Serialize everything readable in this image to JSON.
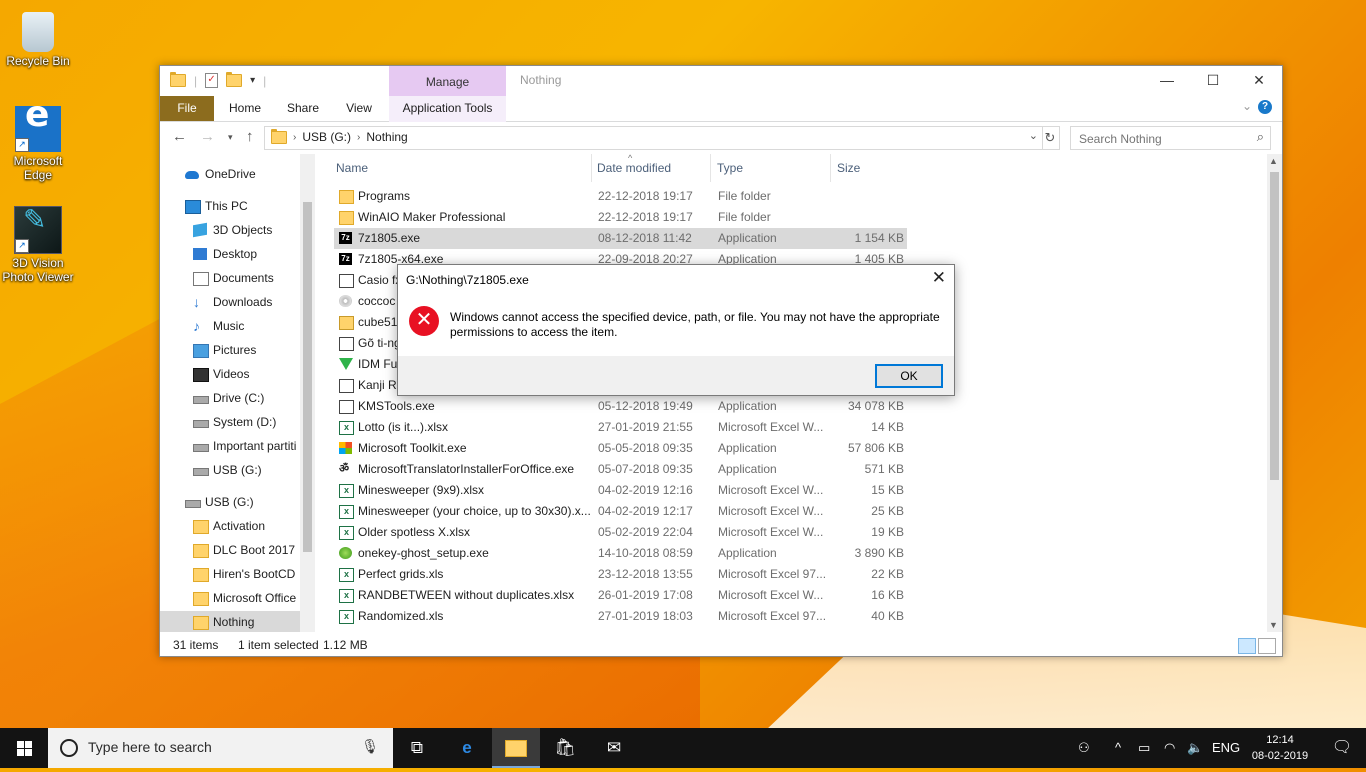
{
  "desktop": {
    "icons": [
      {
        "label": "Recycle Bin",
        "icon": "recycle-bin-icon"
      },
      {
        "label": "Microsoft Edge",
        "icon": "edge-icon"
      },
      {
        "label": "3D Vision Photo Viewer",
        "icon": "3d-vision-icon"
      }
    ]
  },
  "explorer": {
    "manage_tab": "Manage",
    "window_title": "Nothing",
    "ribbon": {
      "tabs": [
        "File",
        "Home",
        "Share",
        "View",
        "Application Tools"
      ]
    },
    "address": {
      "crumbs": [
        "USB (G:)",
        "Nothing"
      ]
    },
    "search": {
      "placeholder": "Search Nothing"
    },
    "nav": [
      {
        "label": "OneDrive",
        "icon": "onedrive-icon"
      },
      {
        "label": "This PC",
        "icon": "computer-icon"
      },
      {
        "label": "3D Objects",
        "icon": "3d-objects-icon"
      },
      {
        "label": "Desktop",
        "icon": "desktop-icon"
      },
      {
        "label": "Documents",
        "icon": "documents-icon"
      },
      {
        "label": "Downloads",
        "icon": "downloads-icon"
      },
      {
        "label": "Music",
        "icon": "music-icon"
      },
      {
        "label": "Pictures",
        "icon": "pictures-icon"
      },
      {
        "label": "Videos",
        "icon": "videos-icon"
      },
      {
        "label": "Drive (C:)",
        "icon": "drive-icon"
      },
      {
        "label": "System (D:)",
        "icon": "drive-icon"
      },
      {
        "label": "Important partiti",
        "icon": "drive-icon"
      },
      {
        "label": "USB (G:)",
        "icon": "usb-drive-icon"
      },
      {
        "label": "USB (G:)",
        "icon": "usb-drive-icon"
      },
      {
        "label": "Activation",
        "icon": "folder-icon"
      },
      {
        "label": "DLC Boot 2017",
        "icon": "folder-icon"
      },
      {
        "label": "Hiren's BootCD",
        "icon": "folder-icon"
      },
      {
        "label": "Microsoft Office",
        "icon": "folder-icon"
      },
      {
        "label": "Nothing",
        "icon": "folder-icon"
      }
    ],
    "columns": [
      "Name",
      "Date modified",
      "Type",
      "Size"
    ],
    "files": [
      {
        "name": "Programs",
        "date": "22-12-2018 19:17",
        "type": "File folder",
        "size": "",
        "icon": "folder-icon"
      },
      {
        "name": "WinAIO Maker Professional",
        "date": "22-12-2018 19:17",
        "type": "File folder",
        "size": "",
        "icon": "folder-icon"
      },
      {
        "name": "7z1805.exe",
        "date": "08-12-2018 11:42",
        "type": "Application",
        "size": "1 154 KB",
        "icon": "7zip-icon"
      },
      {
        "name": "7z1805-x64.exe",
        "date": "22-09-2018 20:27",
        "type": "Application",
        "size": "1 405 KB",
        "icon": "7zip-icon"
      },
      {
        "name": "Casio fx",
        "date": "",
        "type": "",
        "size": "",
        "icon": "file-icon"
      },
      {
        "name": "coccoc",
        "date": "",
        "type": "",
        "size": "",
        "icon": "setup-icon"
      },
      {
        "name": "cube51",
        "date": "",
        "type": "",
        "size": "",
        "icon": "zip-icon"
      },
      {
        "name": "Gõ ti-ng",
        "date": "",
        "type": "",
        "size": "",
        "icon": "file-icon"
      },
      {
        "name": "IDM Fu",
        "date": "",
        "type": "",
        "size": "",
        "icon": "idm-icon"
      },
      {
        "name": "Kanji Ra",
        "date": "",
        "type": "",
        "size": "",
        "icon": "file-icon"
      },
      {
        "name": "KMSTools.exe",
        "date": "05-12-2018 19:49",
        "type": "Application",
        "size": "34 078 KB",
        "icon": "file-icon"
      },
      {
        "name": "Lotto (is it...).xlsx",
        "date": "27-01-2019 21:55",
        "type": "Microsoft Excel W...",
        "size": "14 KB",
        "icon": "excel-icon"
      },
      {
        "name": "Microsoft Toolkit.exe",
        "date": "05-05-2018 09:35",
        "type": "Application",
        "size": "57 806 KB",
        "icon": "microsoft-logo-icon"
      },
      {
        "name": "MicrosoftTranslatorInstallerForOffice.exe",
        "date": "05-07-2018 09:35",
        "type": "Application",
        "size": "571 KB",
        "icon": "translator-icon"
      },
      {
        "name": "Minesweeper (9x9).xlsx",
        "date": "04-02-2019 12:16",
        "type": "Microsoft Excel W...",
        "size": "15 KB",
        "icon": "excel-icon"
      },
      {
        "name": "Minesweeper (your choice, up to 30x30).x...",
        "date": "04-02-2019 12:17",
        "type": "Microsoft Excel W...",
        "size": "25 KB",
        "icon": "excel-icon"
      },
      {
        "name": "Older spotless X.xlsx",
        "date": "05-02-2019 22:04",
        "type": "Microsoft Excel W...",
        "size": "19 KB",
        "icon": "excel-icon"
      },
      {
        "name": "onekey-ghost_setup.exe",
        "date": "14-10-2018 08:59",
        "type": "Application",
        "size": "3 890 KB",
        "icon": "ghost-setup-icon"
      },
      {
        "name": "Perfect grids.xls",
        "date": "23-12-2018 13:55",
        "type": "Microsoft Excel 97...",
        "size": "22 KB",
        "icon": "excel-icon"
      },
      {
        "name": "RANDBETWEEN without duplicates.xlsx",
        "date": "26-01-2019 17:08",
        "type": "Microsoft Excel W...",
        "size": "16 KB",
        "icon": "excel-icon"
      },
      {
        "name": "Randomized.xls",
        "date": "27-01-2019 18:03",
        "type": "Microsoft Excel 97...",
        "size": "40 KB",
        "icon": "excel-icon"
      }
    ],
    "status": {
      "items": "31 items",
      "selected": "1 item selected",
      "size": "1.12 MB"
    }
  },
  "dialog": {
    "title": "G:\\Nothing\\7z1805.exe",
    "message": "Windows cannot access the specified device, path, or file. You may not have the appropriate permissions to access the item.",
    "ok_label": "OK"
  },
  "taskbar": {
    "search_placeholder": "Type here to search",
    "language": "ENG",
    "time": "12:14",
    "date": "08-02-2019"
  }
}
